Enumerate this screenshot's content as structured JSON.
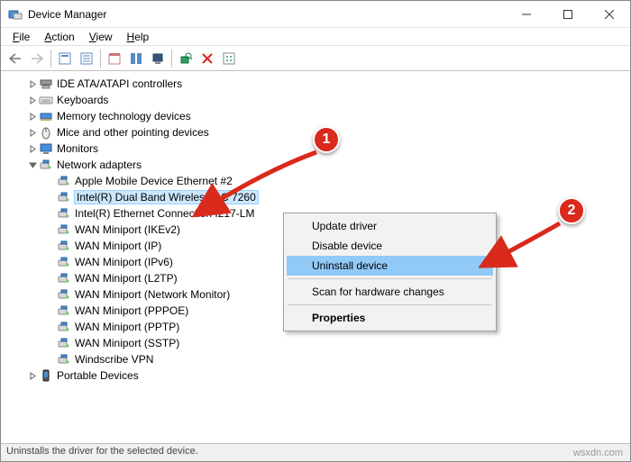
{
  "window": {
    "title": "Device Manager",
    "min": "—",
    "max": "▢",
    "close": "✕"
  },
  "menu": {
    "file": "File",
    "action": "Action",
    "view": "View",
    "help": "Help"
  },
  "toolbar_names": [
    "back",
    "forward",
    "show-hidden",
    "properties",
    "help-topics",
    "legacy",
    "monitor",
    "scan",
    "update",
    "uninstall",
    "views"
  ],
  "tree": {
    "items": [
      {
        "indent": 1,
        "exp": ">",
        "icon": "controller",
        "label": "IDE ATA/ATAPI controllers"
      },
      {
        "indent": 1,
        "exp": ">",
        "icon": "keyboard",
        "label": "Keyboards"
      },
      {
        "indent": 1,
        "exp": ">",
        "icon": "memory",
        "label": "Memory technology devices"
      },
      {
        "indent": 1,
        "exp": ">",
        "icon": "mouse",
        "label": "Mice and other pointing devices"
      },
      {
        "indent": 1,
        "exp": ">",
        "icon": "monitor",
        "label": "Monitors"
      },
      {
        "indent": 1,
        "exp": "v",
        "icon": "network",
        "label": "Network adapters"
      },
      {
        "indent": 2,
        "exp": "",
        "icon": "network",
        "label": "Apple Mobile Device Ethernet #2"
      },
      {
        "indent": 2,
        "exp": "",
        "icon": "network",
        "label": "Intel(R) Dual Band Wireless-AC 7260",
        "selected": true
      },
      {
        "indent": 2,
        "exp": "",
        "icon": "network",
        "label": "Intel(R) Ethernet Connection I217-LM"
      },
      {
        "indent": 2,
        "exp": "",
        "icon": "network",
        "label": "WAN Miniport (IKEv2)"
      },
      {
        "indent": 2,
        "exp": "",
        "icon": "network",
        "label": "WAN Miniport (IP)"
      },
      {
        "indent": 2,
        "exp": "",
        "icon": "network",
        "label": "WAN Miniport (IPv6)"
      },
      {
        "indent": 2,
        "exp": "",
        "icon": "network",
        "label": "WAN Miniport (L2TP)"
      },
      {
        "indent": 2,
        "exp": "",
        "icon": "network",
        "label": "WAN Miniport (Network Monitor)"
      },
      {
        "indent": 2,
        "exp": "",
        "icon": "network",
        "label": "WAN Miniport (PPPOE)"
      },
      {
        "indent": 2,
        "exp": "",
        "icon": "network",
        "label": "WAN Miniport (PPTP)"
      },
      {
        "indent": 2,
        "exp": "",
        "icon": "network",
        "label": "WAN Miniport (SSTP)"
      },
      {
        "indent": 2,
        "exp": "",
        "icon": "network",
        "label": "Windscribe VPN"
      },
      {
        "indent": 1,
        "exp": ">",
        "icon": "portable",
        "label": "Portable Devices"
      }
    ]
  },
  "context_menu": {
    "update": "Update driver",
    "disable": "Disable device",
    "uninstall": "Uninstall device",
    "scan": "Scan for hardware changes",
    "properties": "Properties"
  },
  "statusbar": "Uninstalls the driver for the selected device.",
  "callouts": {
    "one": "1",
    "two": "2"
  },
  "watermark": "wsxdn.com"
}
